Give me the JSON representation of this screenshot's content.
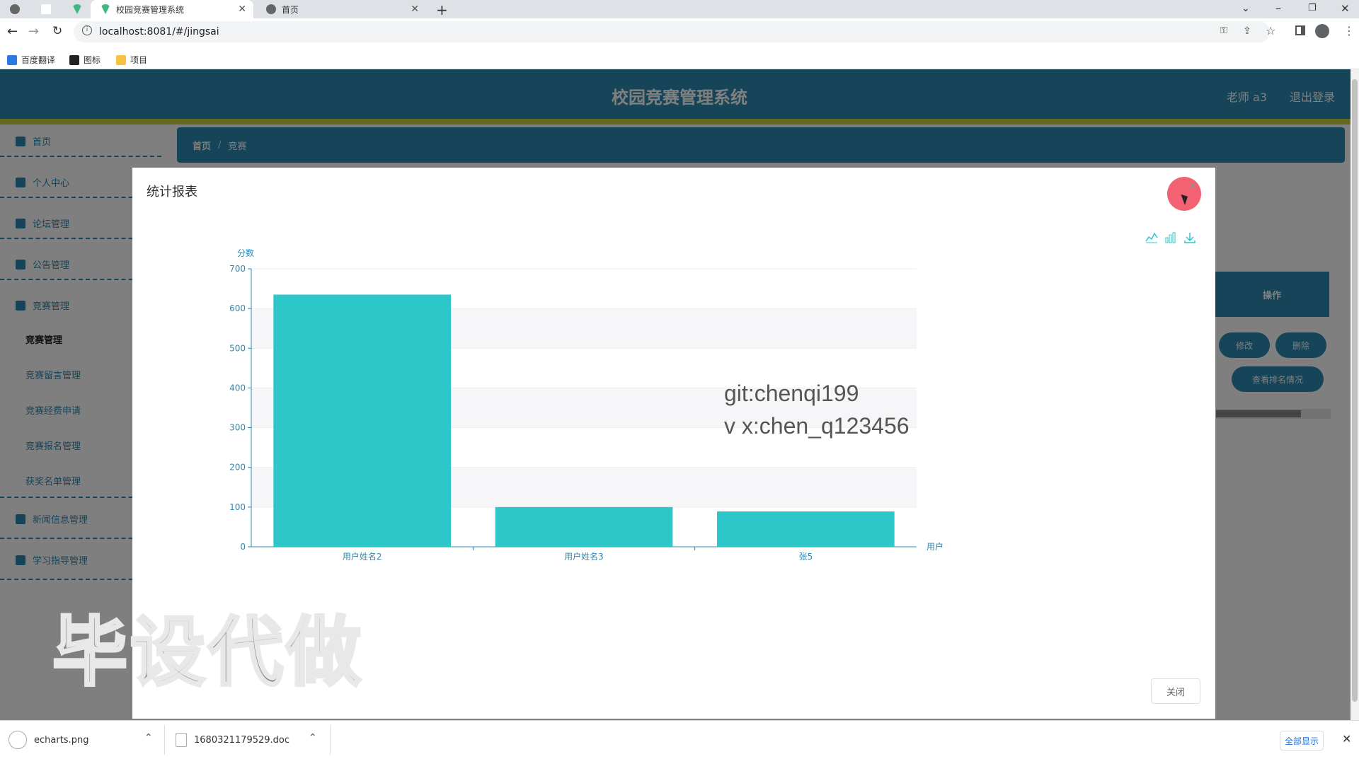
{
  "browser": {
    "tabs": [
      {
        "title": "",
        "active": false
      },
      {
        "title": "",
        "active": false
      },
      {
        "title": "",
        "active": false
      },
      {
        "title": "校园竞赛管理系统",
        "active": true
      },
      {
        "title": "首页",
        "active": false
      }
    ],
    "new_tab": "+",
    "url": "localhost:8081/#/jingsai",
    "bookmarks": [
      {
        "label": "百度翻译"
      },
      {
        "label": "图标"
      },
      {
        "label": "项目"
      }
    ]
  },
  "app": {
    "title": "校园竞赛管理系统",
    "user": "老师 a3",
    "logout": "退出登录",
    "sidebar": {
      "items": [
        {
          "label": "首页",
          "icon": "home-icon"
        },
        {
          "label": "个人中心",
          "icon": "user-icon"
        },
        {
          "label": "论坛管理",
          "icon": "forum-icon"
        },
        {
          "label": "公告管理",
          "icon": "briefcase-icon"
        },
        {
          "label": "竞赛管理",
          "icon": "menu-icon"
        },
        {
          "label": "新闻信息管理",
          "icon": "chat-icon"
        },
        {
          "label": "学习指导管理",
          "icon": "menu-icon"
        }
      ],
      "sub_items": [
        {
          "label": "竞赛管理",
          "active": true
        },
        {
          "label": "竞赛留言管理",
          "active": false
        },
        {
          "label": "竞赛经费申请",
          "active": false
        },
        {
          "label": "竞赛报名管理",
          "active": false
        },
        {
          "label": "获奖名单管理",
          "active": false
        }
      ]
    },
    "breadcrumb": [
      "首页",
      "竞赛"
    ],
    "breadcrumb_sep": "/",
    "table": {
      "ops_header": "操作",
      "buttons": {
        "edit": "修改",
        "delete": "删除",
        "rank": "查看排名情况"
      }
    }
  },
  "modal": {
    "title": "统计报表",
    "close_button": "关闭",
    "toolbox": [
      "line-chart-icon",
      "bar-chart-icon",
      "download-icon"
    ],
    "watermark_lines": [
      "git:chenqi199",
      "v x:chen_q123456"
    ]
  },
  "overlay_stamp": "毕设代做",
  "chart_data": {
    "type": "bar",
    "categories": [
      "用户姓名2",
      "用户姓名3",
      "张5"
    ],
    "values": [
      635,
      100,
      89
    ],
    "xlabel": "用户",
    "ylabel": "分数",
    "ylim": [
      0,
      700
    ],
    "yticks": [
      0,
      100,
      200,
      300,
      400,
      500,
      600,
      700
    ],
    "color": "#2ec7c9",
    "grid": true
  },
  "downloads": {
    "items": [
      {
        "name": "echarts.png"
      },
      {
        "name": "1680321179529.doc"
      }
    ],
    "show_all": "全部显示"
  },
  "colors": {
    "primary": "#2d88b0",
    "accent_bar": "#c8d23a",
    "bar": "#2ec7c9"
  }
}
